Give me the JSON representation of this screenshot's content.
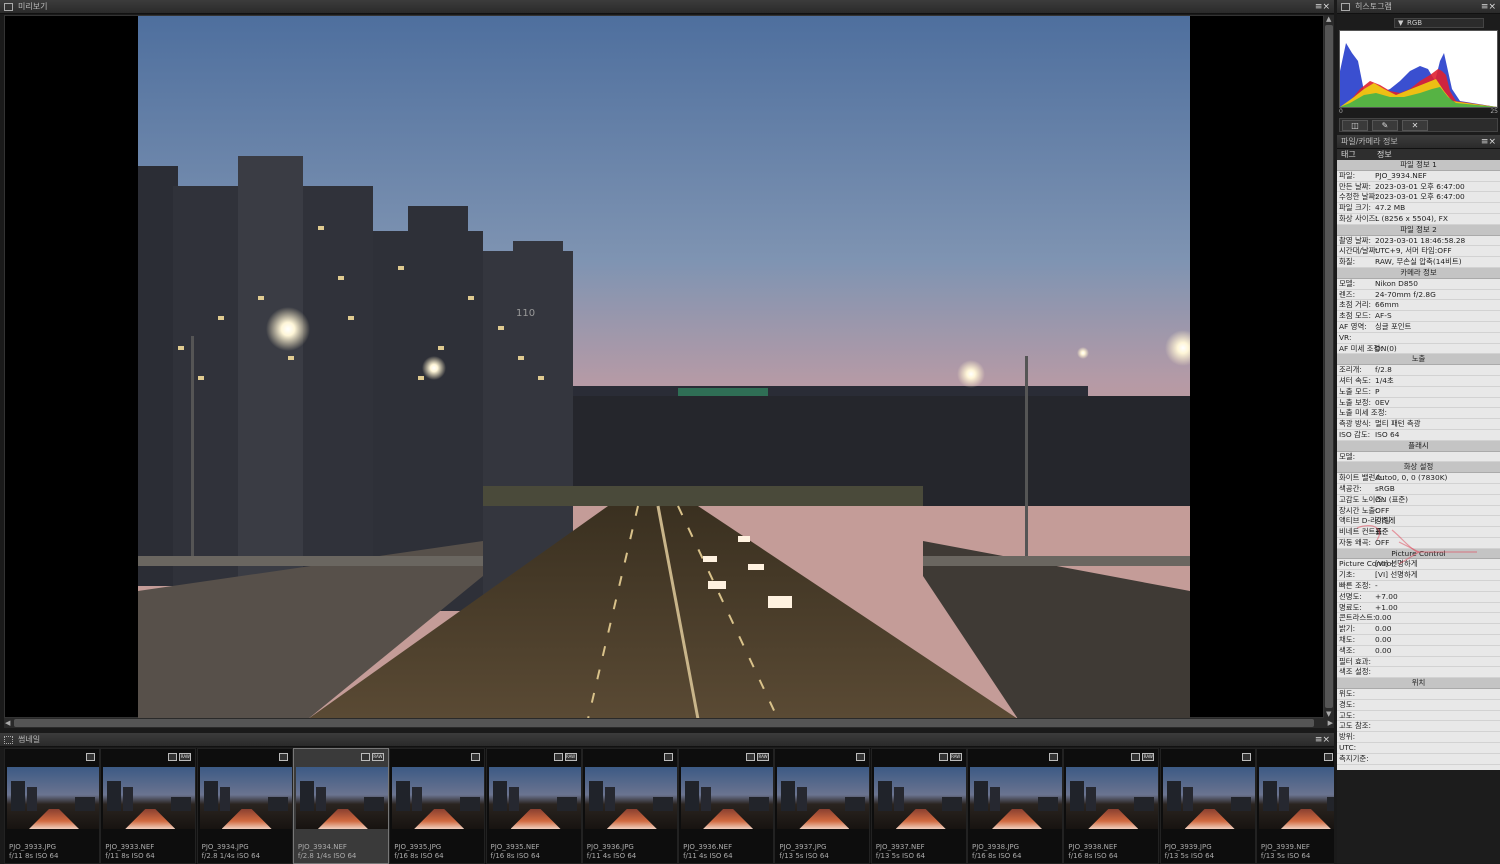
{
  "preview": {
    "title": "미리보기"
  },
  "thumbnails": {
    "title": "썸네일",
    "items": [
      {
        "name": "PJO_3933.JPG",
        "info": "f/11 8s ISO 64",
        "raw": false,
        "selected": false
      },
      {
        "name": "PJO_3933.NEF",
        "info": "f/11 8s ISO 64",
        "raw": true,
        "selected": false
      },
      {
        "name": "PJO_3934.JPG",
        "info": "f/2.8 1/4s ISO 64",
        "raw": false,
        "selected": false
      },
      {
        "name": "PJO_3934.NEF",
        "info": "f/2.8 1/4s ISO 64",
        "raw": true,
        "selected": true
      },
      {
        "name": "PJO_3935.JPG",
        "info": "f/16 8s ISO 64",
        "raw": false,
        "selected": false
      },
      {
        "name": "PJO_3935.NEF",
        "info": "f/16 8s ISO 64",
        "raw": true,
        "selected": false
      },
      {
        "name": "PJO_3936.JPG",
        "info": "f/11 4s ISO 64",
        "raw": false,
        "selected": false
      },
      {
        "name": "PJO_3936.NEF",
        "info": "f/11 4s ISO 64",
        "raw": true,
        "selected": false
      },
      {
        "name": "PJO_3937.JPG",
        "info": "f/13 5s ISO 64",
        "raw": false,
        "selected": false
      },
      {
        "name": "PJO_3937.NEF",
        "info": "f/13 5s ISO 64",
        "raw": true,
        "selected": false
      },
      {
        "name": "PJO_3938.JPG",
        "info": "f/16 8s ISO 64",
        "raw": false,
        "selected": false
      },
      {
        "name": "PJO_3938.NEF",
        "info": "f/16 8s ISO 64",
        "raw": true,
        "selected": false
      },
      {
        "name": "PJO_3939.JPG",
        "info": "f/13 5s ISO 64",
        "raw": false,
        "selected": false
      },
      {
        "name": "PJO_3939.NEF",
        "info": "f/13 5s ISO 64",
        "raw": true,
        "selected": false
      }
    ]
  },
  "histogram": {
    "title": "히스토그램",
    "channel": "RGB",
    "scale_min": "0",
    "scale_max": "25"
  },
  "info_panel": {
    "title": "파일/카메라 정보",
    "col_tag": "태그",
    "col_info": "정보",
    "rows": [
      {
        "section": "파일 정보 1"
      },
      {
        "k": "파일:",
        "v": "PJO_3934.NEF"
      },
      {
        "k": "만든 날짜:",
        "v": "2023-03-01 오후 6:47:00"
      },
      {
        "k": "수정한 날짜:",
        "v": "2023-03-01 오후 6:47:00"
      },
      {
        "k": "파일 크기:",
        "v": "47.2 MB"
      },
      {
        "k": "화상 사이즈:",
        "v": "L (8256 x 5504), FX"
      },
      {
        "section": "파일 정보 2"
      },
      {
        "k": "촬영 날짜:",
        "v": "2023-03-01 18:46:58.28"
      },
      {
        "k": "시간대/날짜:",
        "v": "UTC+9, 서머 타임:OFF"
      },
      {
        "k": "화질:",
        "v": "RAW, 무손실 압축(14비트)"
      },
      {
        "section": "카메라 정보"
      },
      {
        "k": "모델:",
        "v": "Nikon D850"
      },
      {
        "k": "렌즈:",
        "v": "24-70mm f/2.8G"
      },
      {
        "k": "초점 거리:",
        "v": "66mm"
      },
      {
        "k": "초점 모드:",
        "v": "AF-S"
      },
      {
        "k": "AF 영역:",
        "v": "싱글 포인트"
      },
      {
        "k": "VR:",
        "v": ""
      },
      {
        "k": "AF 미세 조정:",
        "v": "ON(0)"
      },
      {
        "section": "노출"
      },
      {
        "k": "조리개:",
        "v": "f/2.8"
      },
      {
        "k": "셔터 속도:",
        "v": "1/4초"
      },
      {
        "k": "노출 모드:",
        "v": "P"
      },
      {
        "k": "노출 보정:",
        "v": "0EV"
      },
      {
        "k": "노출 미세 조정:",
        "v": ""
      },
      {
        "k": "측광 방식:",
        "v": "멀티 패턴 측광"
      },
      {
        "k": "ISO 감도:",
        "v": "ISO 64"
      },
      {
        "section": "플래시"
      },
      {
        "k": "모델:",
        "v": ""
      },
      {
        "section": "화상 설정"
      },
      {
        "k": "화이트 밸런스:",
        "v": "Auto0, 0, 0 (7830K)"
      },
      {
        "k": "색공간:",
        "v": "sRGB"
      },
      {
        "k": "고감도 노이즈:",
        "v": "ON (표준)"
      },
      {
        "k": "장시간 노출:",
        "v": "OFF"
      },
      {
        "k": "액티브 D-라이팅:",
        "v": "강하게"
      },
      {
        "k": "비네트 컨트롤:",
        "v": "표준"
      },
      {
        "k": "자동 왜곡:",
        "v": "OFF"
      },
      {
        "section": "Picture Control"
      },
      {
        "k": "Picture Control:",
        "v": "[VI] 선명하게"
      },
      {
        "k": "기초:",
        "v": "[VI] 선명하게"
      },
      {
        "k": "빠른 조정:",
        "v": "-"
      },
      {
        "k": "선명도:",
        "v": "+7.00"
      },
      {
        "k": "명료도:",
        "v": "+1.00"
      },
      {
        "k": "콘트라스트:",
        "v": "0.00"
      },
      {
        "k": "밝기:",
        "v": "0.00"
      },
      {
        "k": "채도:",
        "v": "0.00"
      },
      {
        "k": "색조:",
        "v": "0.00"
      },
      {
        "k": "필터 효과:",
        "v": ""
      },
      {
        "k": "색조 설정:",
        "v": ""
      },
      {
        "section": "위치"
      },
      {
        "k": "위도:",
        "v": ""
      },
      {
        "k": "경도:",
        "v": ""
      },
      {
        "k": "고도:",
        "v": ""
      },
      {
        "k": "고도 참조:",
        "v": ""
      },
      {
        "k": "방위:",
        "v": ""
      },
      {
        "k": "UTC:",
        "v": ""
      },
      {
        "k": "측지기준:",
        "v": ""
      }
    ]
  },
  "header_controls": {
    "menu": "≡×"
  }
}
